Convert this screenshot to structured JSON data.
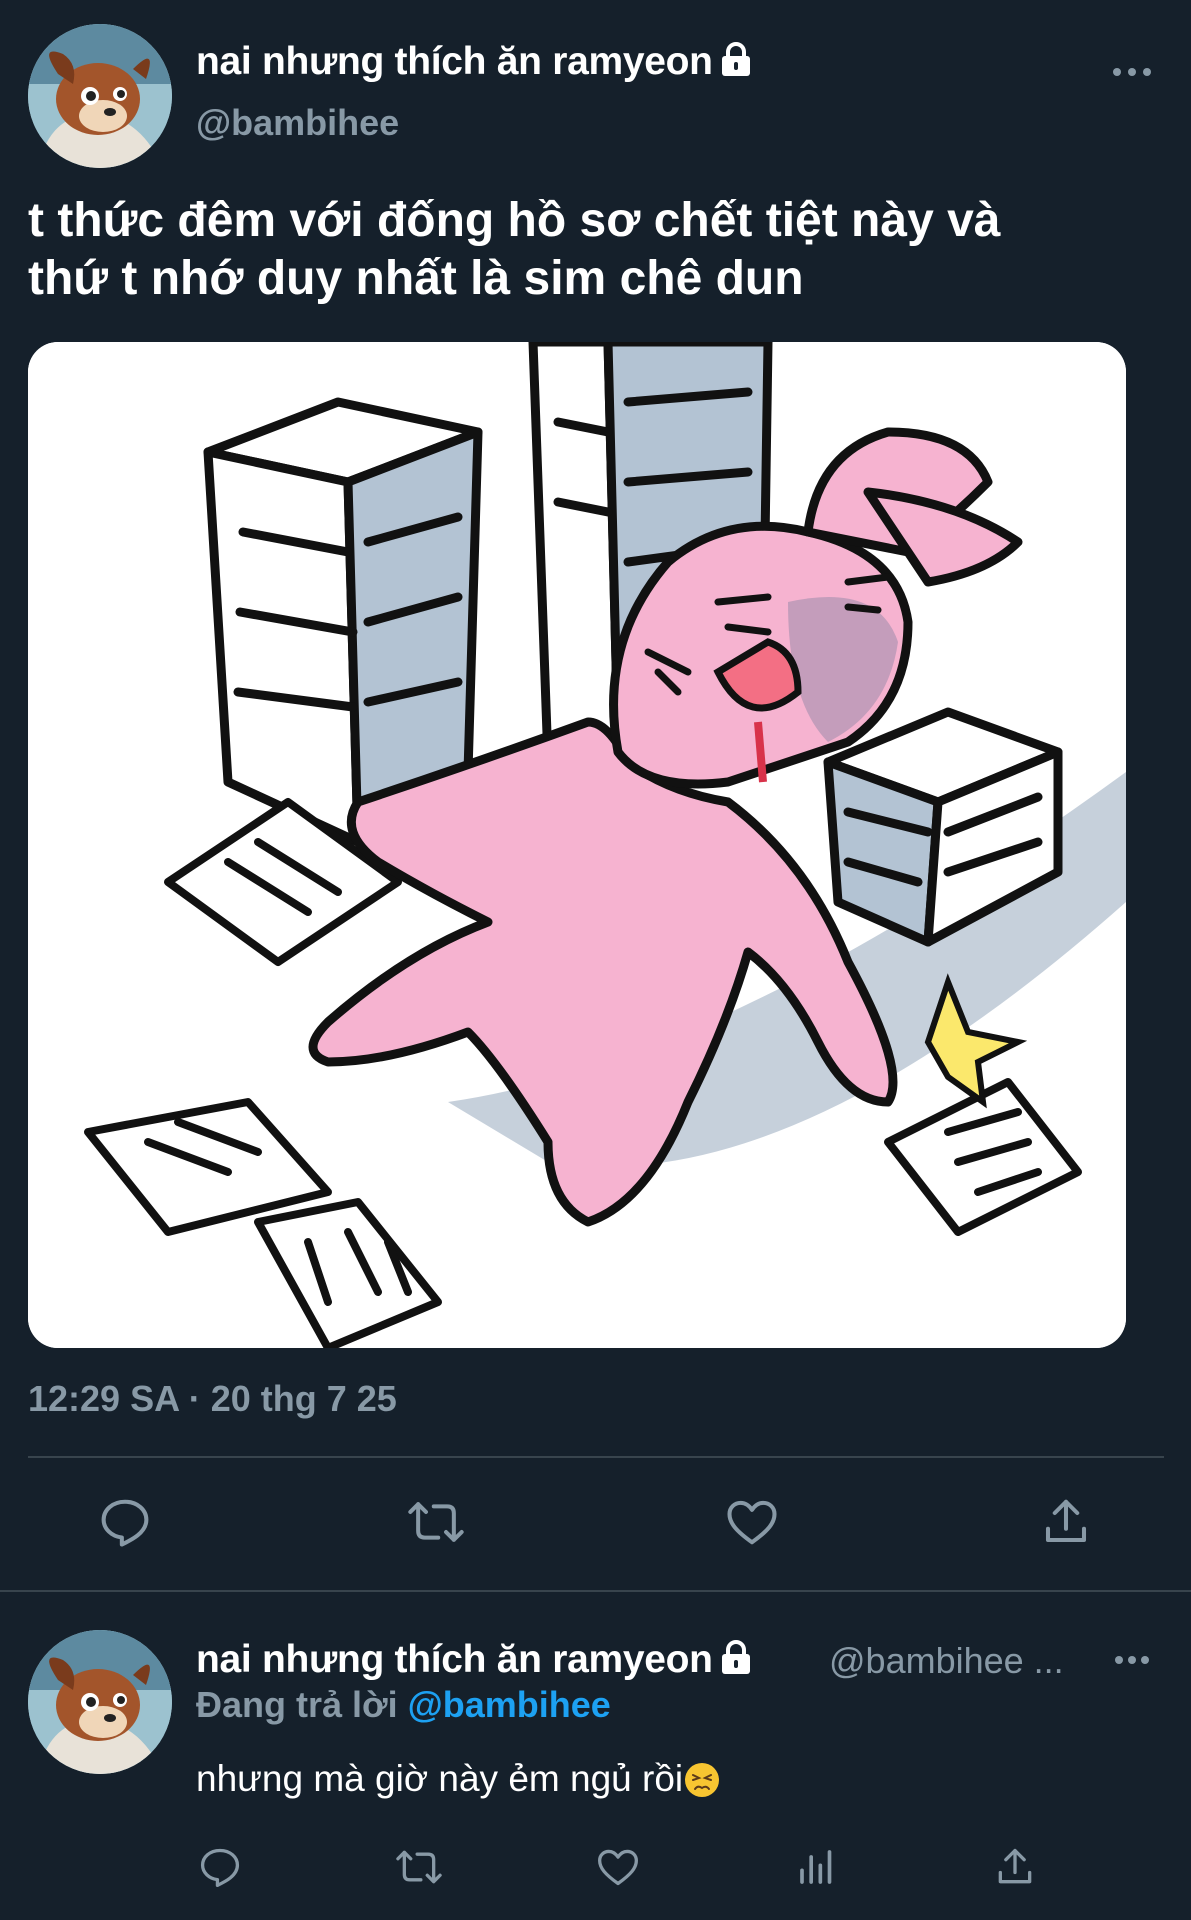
{
  "colors": {
    "background": "#15202b",
    "muted": "#8899a6",
    "accent": "#1da1f2",
    "divider": "#38444d"
  },
  "main_tweet": {
    "display_name": "nai nhưng thích ăn ramyeon",
    "handle": "@bambihee",
    "protected_icon": "lock-icon",
    "text_lines": [
      "t thức đêm với đống hồ sơ chết tiệt này và",
      "thứ t nhớ duy nhất là sim chê dun"
    ],
    "media_icon": "bunny-cartoon-with-paper-stacks",
    "timestamp": "12:29 SA · 20 thg 7 25",
    "actions": [
      "reply-icon",
      "retweet-icon",
      "like-icon",
      "share-icon"
    ]
  },
  "reply_tweet": {
    "display_name": "nai nhưng thích ăn ramyeon",
    "handle": "@bambihee ...",
    "replying_to_prefix": "Đang trả lời ",
    "replying_to_handle": "@bambihee",
    "text": "nhưng mà giờ này ẻm ngủ rồi",
    "emoji": "persevering-face-emoji",
    "actions": [
      "reply-icon",
      "retweet-icon",
      "like-icon",
      "analytics-icon",
      "share-icon"
    ]
  }
}
